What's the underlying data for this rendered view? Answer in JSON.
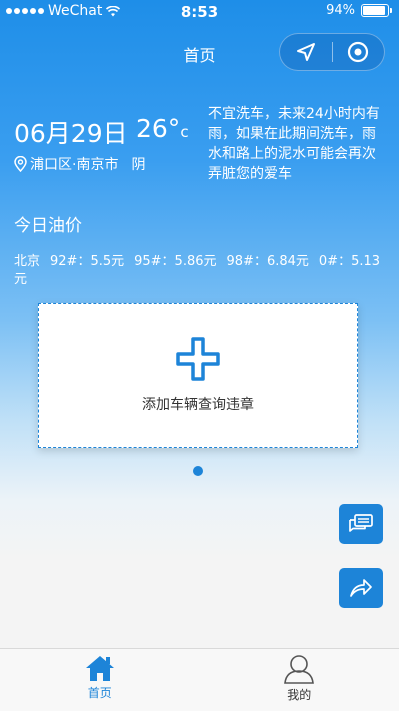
{
  "status_bar": {
    "carrier": "WeChat",
    "time": "8:53",
    "battery": "94%",
    "battery_level": 0.94
  },
  "nav": {
    "title": "首页",
    "capsule_icons": [
      "location-arrow-icon",
      "target-circle-icon"
    ]
  },
  "weather": {
    "date": "06月29日",
    "temperature": "26°",
    "temp_unit": "c",
    "location": "浦口区·南京市",
    "condition": "阴",
    "tip": "不宜洗车，未来24小时内有雨，如果在此期间洗车，雨水和路上的泥水可能会再次弄脏您的爱车"
  },
  "oil": {
    "title": "今日油价",
    "city": "北京",
    "prices": [
      "92#：5.5元",
      "95#：5.86元",
      "98#：6.84元",
      "0#：5.13元"
    ]
  },
  "card": {
    "label": "添加车辆查询违章",
    "icon": "plus-icon"
  },
  "fabs": {
    "chat_icon": "chat-bubbles-icon",
    "share_icon": "share-arrow-icon"
  },
  "tabbar": {
    "tabs": [
      {
        "label": "首页",
        "icon": "home-icon",
        "active": true
      },
      {
        "label": "我的",
        "icon": "user-icon",
        "active": false
      }
    ]
  },
  "colors": {
    "accent": "#1d84d8",
    "header_top": "#1e8ee8",
    "background": "#f4f4f4"
  }
}
